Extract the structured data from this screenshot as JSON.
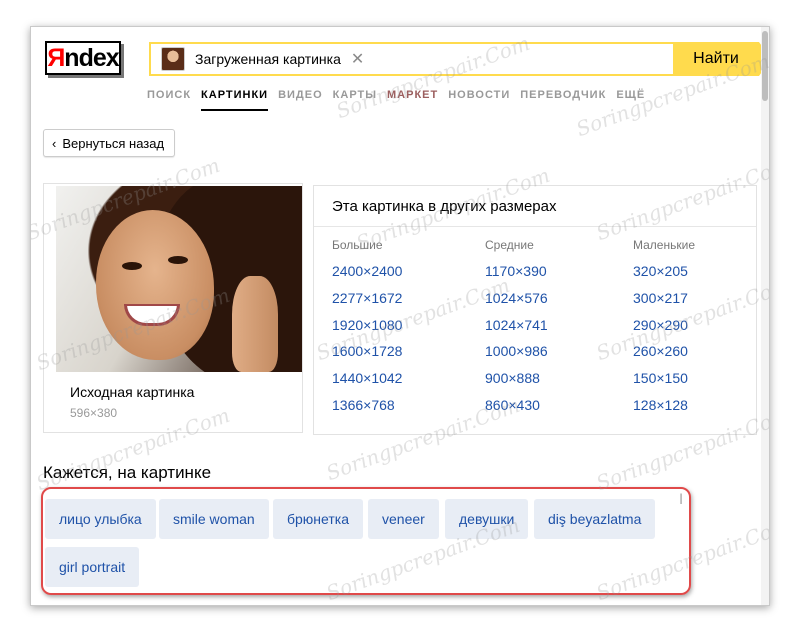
{
  "logo": {
    "text_red": "Я",
    "text_black": "ndex"
  },
  "search": {
    "query": "Загруженная картинка",
    "find_label": "Найти"
  },
  "nav": {
    "items": [
      "ПОИСК",
      "КАРТИНКИ",
      "ВИДЕО",
      "КАРТЫ",
      "МАРКЕТ",
      "НОВОСТИ",
      "ПЕРЕВОДЧИК",
      "ЕЩЁ"
    ],
    "active": "КАРТИНКИ"
  },
  "back_label": "Вернуться назад",
  "source": {
    "title": "Исходная картинка",
    "size": "596×380"
  },
  "sizes": {
    "title": "Эта картинка в других размерах",
    "columns": [
      {
        "heading": "Большие",
        "links": [
          "2400×2400",
          "2277×1672",
          "1920×1080",
          "1600×1728",
          "1440×1042",
          "1366×768"
        ]
      },
      {
        "heading": "Средние",
        "links": [
          "1170×390",
          "1024×576",
          "1024×741",
          "1000×986",
          "900×888",
          "860×430"
        ]
      },
      {
        "heading": "Маленькие",
        "links": [
          "320×205",
          "300×217",
          "290×290",
          "260×260",
          "150×150",
          "128×128"
        ]
      }
    ]
  },
  "hint_title": "Кажется, на картинке",
  "tags": [
    "лицо улыбка",
    "smile woman",
    "брюнетка",
    "veneer",
    "девушки",
    "diş beyazlatma",
    "girl portrait"
  ],
  "watermark": "Soringpcrepair.Com",
  "colors": {
    "accent_yellow": "#ffdb4d",
    "link_blue": "#1f52a8",
    "highlight_red": "#e04a4a",
    "logo_red": "#ff0000"
  }
}
